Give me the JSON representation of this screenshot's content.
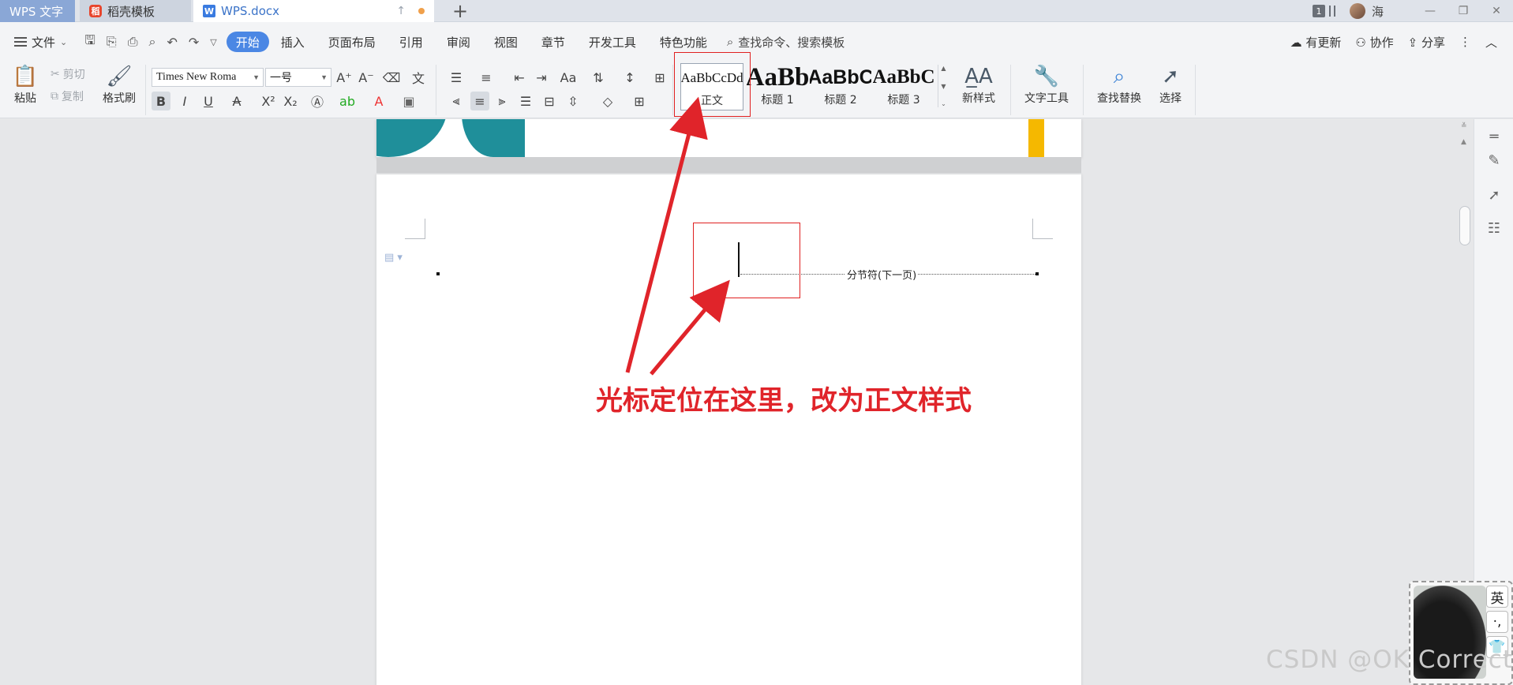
{
  "tabs": {
    "wps": "WPS 文字",
    "template": "稻壳模板",
    "doc": "WPS.docx",
    "doc_icon": "W",
    "template_icon": "稻"
  },
  "titlebar": {
    "badge": "1",
    "user": "海"
  },
  "menu": {
    "file": "文件",
    "tabs": [
      "开始",
      "插入",
      "页面布局",
      "引用",
      "审阅",
      "视图",
      "章节",
      "开发工具",
      "特色功能"
    ],
    "search": "查找命令、搜索模板",
    "update": "有更新",
    "collab": "协作",
    "share": "分享"
  },
  "ribbon": {
    "paste": "粘贴",
    "cut": "剪切",
    "copy": "复制",
    "format_painter": "格式刷",
    "font_name": "Times New Roma",
    "font_size": "一号",
    "styles": [
      {
        "sample": "AaBbCcDd",
        "label": "正文"
      },
      {
        "sample": "AaBb",
        "label": "标题 1"
      },
      {
        "sample": "AaBbC",
        "label": "标题 2"
      },
      {
        "sample": "AaBbC",
        "label": "标题 3"
      }
    ],
    "new_style": "新样式",
    "text_tools": "文字工具",
    "find_replace": "查找替换",
    "select": "选择"
  },
  "document": {
    "section_break": "分节符(下一页)",
    "annotation": "光标定位在这里，改为正文样式"
  },
  "ime": {
    "lang": "英",
    "punct": "·,",
    "shirt": "👕"
  },
  "watermark": "CSDN @OK Correct",
  "colors": {
    "accent": "#4b87e4",
    "annotation_red": "#e0242a",
    "teal": "#1f8f9a",
    "yellow": "#f5b800"
  }
}
